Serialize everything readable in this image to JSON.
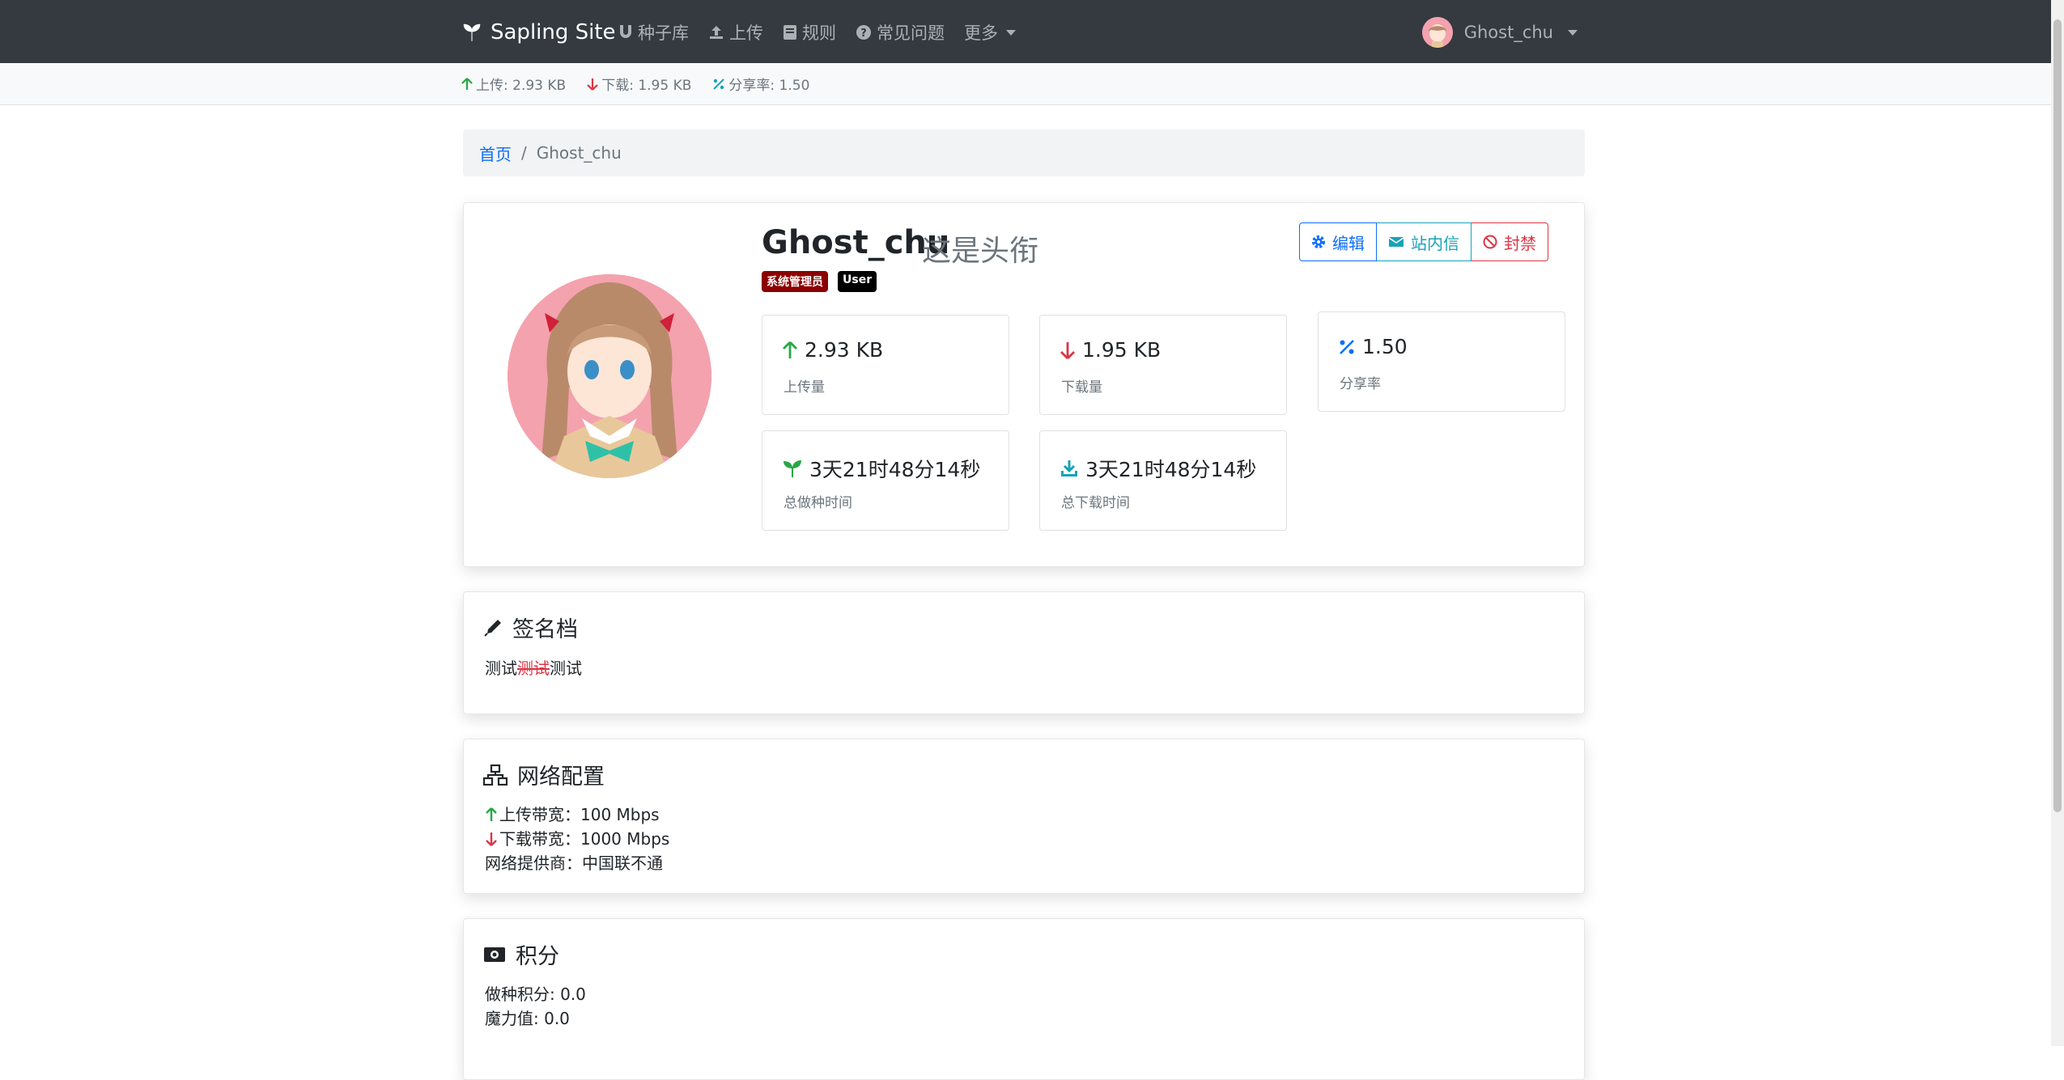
{
  "navbar": {
    "brand": "Sapling Site",
    "items": [
      {
        "label": "种子库",
        "icon": "magnet-icon"
      },
      {
        "label": "上传",
        "icon": "upload-icon"
      },
      {
        "label": "规则",
        "icon": "book-icon"
      },
      {
        "label": "常见问题",
        "icon": "question-icon"
      },
      {
        "label": "更多",
        "icon": "caret-icon"
      }
    ],
    "user": "Ghost_chu"
  },
  "statsbar": {
    "upload": "上传: 2.93 KB",
    "download": "下载: 1.95 KB",
    "ratio": "分享率: 1.50"
  },
  "breadcrumb": {
    "home": "首页",
    "current": "Ghost_chu"
  },
  "profile": {
    "name": "Ghost_chu",
    "title": "这是头衔",
    "badges": [
      "系统管理员",
      "User"
    ],
    "buttons": {
      "edit": "编辑",
      "message": "站内信",
      "ban": "封禁"
    },
    "stats": {
      "upload": {
        "value": "2.93 KB",
        "label": "上传量"
      },
      "download": {
        "value": "1.95 KB",
        "label": "下载量"
      },
      "ratio": {
        "value": "1.50",
        "label": "分享率"
      },
      "seed_time": {
        "value": "3天21时48分14秒",
        "label": "总做种时间"
      },
      "download_time": {
        "value": "3天21时48分14秒",
        "label": "总下载时间"
      }
    }
  },
  "signature": {
    "title": "签名档",
    "text_before": "测试",
    "text_mark": "测试",
    "text_after": "测试"
  },
  "network": {
    "title": "网络配置",
    "upload_bw": "上传带宽：100 Mbps",
    "download_bw": "下载带宽：1000 Mbps",
    "isp": "网络提供商：中国联不通"
  },
  "points": {
    "title": "积分",
    "seed_points": "做种积分: 0.0",
    "magic": "魔力值: 0.0"
  },
  "colors": {
    "navbar": "#343a40",
    "primary": "#0d6efd",
    "danger": "#dc3545",
    "info": "#17a2b8",
    "success": "#28a745"
  }
}
